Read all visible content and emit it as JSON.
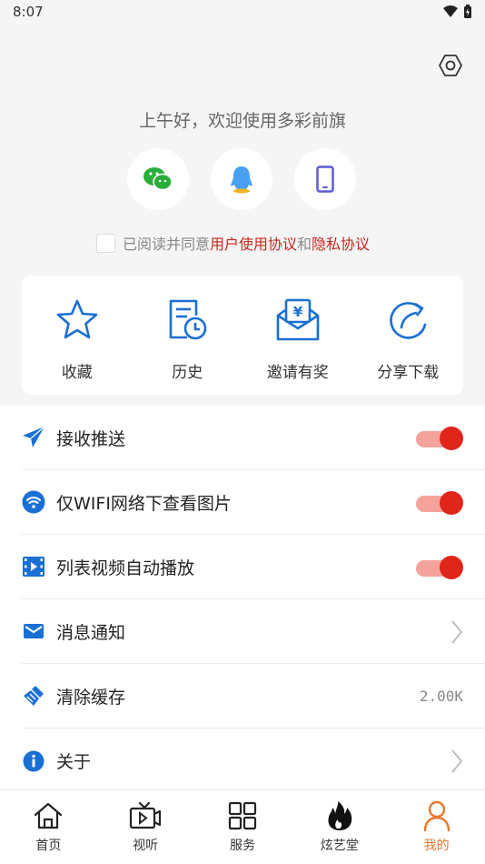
{
  "status_bar": {
    "time": "8:07"
  },
  "greeting": "上午好，欢迎使用多彩前旗",
  "login_options": [
    {
      "icon": "wechat-icon"
    },
    {
      "icon": "qq-icon"
    },
    {
      "icon": "phone-icon"
    }
  ],
  "agreement": {
    "prefix": "已阅读并同意",
    "user_agreement": "用户使用协议",
    "conjunction": "和",
    "privacy_agreement": "隐私协议"
  },
  "quick_actions": [
    {
      "label": "收藏",
      "icon": "star-icon"
    },
    {
      "label": "历史",
      "icon": "history-icon"
    },
    {
      "label": "邀请有奖",
      "icon": "invite-reward-icon"
    },
    {
      "label": "分享下载",
      "icon": "share-icon"
    }
  ],
  "settings": [
    {
      "label": "接收推送",
      "icon": "send-icon",
      "type": "toggle",
      "on": true
    },
    {
      "label": "仅WIFI网络下查看图片",
      "icon": "wifi-icon",
      "type": "toggle",
      "on": true
    },
    {
      "label": "列表视频自动播放",
      "icon": "video-icon",
      "type": "toggle",
      "on": true
    },
    {
      "label": "消息通知",
      "icon": "mail-icon",
      "type": "arrow"
    },
    {
      "label": "清除缓存",
      "icon": "broom-icon",
      "type": "value",
      "value": "2.00K"
    },
    {
      "label": "关于",
      "icon": "info-icon",
      "type": "arrow"
    }
  ],
  "tabs": [
    {
      "label": "首页",
      "icon": "home-icon",
      "active": false
    },
    {
      "label": "视听",
      "icon": "tv-icon",
      "active": false
    },
    {
      "label": "服务",
      "icon": "grid-icon",
      "active": false
    },
    {
      "label": "炫艺堂",
      "icon": "flame-icon",
      "active": false
    },
    {
      "label": "我的",
      "icon": "profile-icon",
      "active": true
    }
  ],
  "colors": {
    "accent_red": "#e0251b",
    "link_red": "#c8281e",
    "blue": "#1a73e8",
    "active_tab": "#e8772e"
  }
}
